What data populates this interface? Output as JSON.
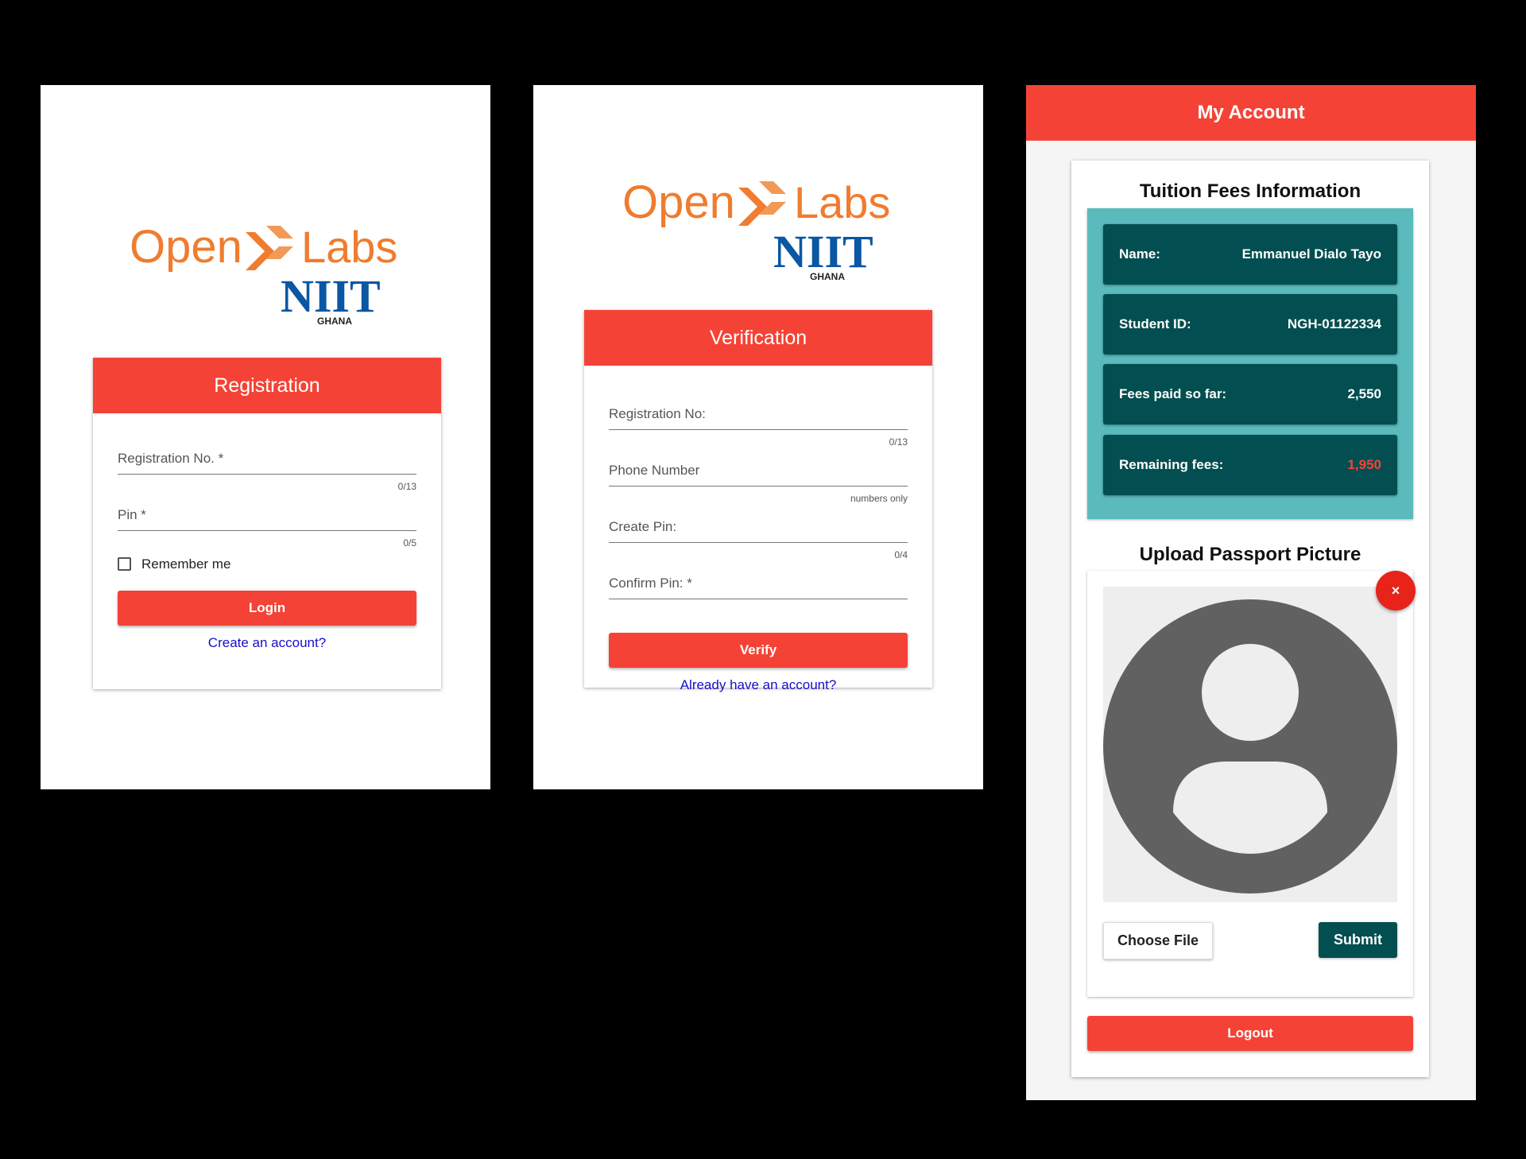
{
  "colors": {
    "accent_red": "#f44336",
    "teal_dark": "#034e50",
    "teal_light": "#5bbabc",
    "link_blue": "#1a0dcc",
    "logo_orange": "#ef7c2f",
    "logo_blue": "#0a57a3"
  },
  "logo": {
    "word_open": "Open",
    "word_labs": "Labs",
    "word_niit": "NIIT",
    "word_ghana": "GHANA"
  },
  "registration": {
    "title": "Registration",
    "fields": [
      {
        "label": "Registration No. *",
        "hint": "0/13"
      },
      {
        "label": "Pin *",
        "hint": "0/5"
      }
    ],
    "remember_label": "Remember me",
    "login_label": "Login",
    "create_link": "Create an account?"
  },
  "verification": {
    "title": "Verification",
    "fields": [
      {
        "label": "Registration No:",
        "hint": "0/13"
      },
      {
        "label": "Phone Number",
        "hint": "numbers only"
      },
      {
        "label": "Create Pin:",
        "hint": "0/4"
      },
      {
        "label": "Confirm Pin: *",
        "hint": ""
      }
    ],
    "verify_label": "Verify",
    "login_link": "Already have an account?"
  },
  "account": {
    "header": "My Account",
    "fees_title": "Tuition Fees Information",
    "rows": [
      {
        "label": "Name:",
        "value": "Emmanuel Dialo Tayo"
      },
      {
        "label": "Student ID:",
        "value": "NGH-01122334"
      },
      {
        "label": "Fees paid so far:",
        "value": "2,550"
      },
      {
        "label": "Remaining fees:",
        "value": "1,950"
      }
    ],
    "upload_title": "Upload Passport Picture",
    "close_symbol": "×",
    "choose_label": "Choose File",
    "submit_label": "Submit",
    "logout_label": "Logout",
    "avatar_icon": "account-circle-icon"
  }
}
